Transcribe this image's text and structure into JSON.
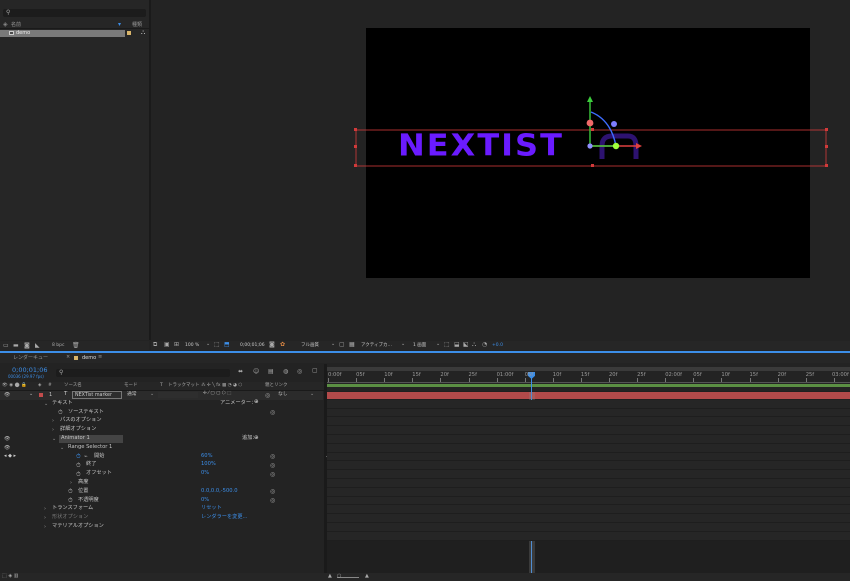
{
  "project": {
    "search_placeholder": "",
    "col_name": "名前",
    "col_type": "種類",
    "item_name": "demo",
    "bpc": "8 bpc"
  },
  "viewer": {
    "title_text": "NEXTIST",
    "zoom": "100 %",
    "timecode": "0;00;01;06",
    "resolution": "フル画質",
    "camera": "アクティブカ…",
    "views": "1 画面",
    "offset": "+0.0"
  },
  "timeline": {
    "tabs": [
      "レンダーキュー",
      "demo"
    ],
    "timecode": "0;00;01;06",
    "frame_info": "00036 (29.97 fps)",
    "col_source": "ソース名",
    "col_mode": "モード",
    "col_t": "T",
    "col_trkmat": "トラックマット",
    "col_parent": "親とリンク",
    "layer": {
      "num": "1",
      "name": "NEXTist marker",
      "mode": "通常",
      "parent": "なし"
    },
    "props": {
      "text": "テキスト",
      "animator_label": "アニメーター：",
      "source_text": "ソーステキスト",
      "path_options": "パスのオプション",
      "more_options": "詳細オプション",
      "animator1": "Animator 1",
      "add_label": "追加：",
      "range_selector": "Range Selector 1",
      "start": "開始",
      "start_value": "60%",
      "end": "終了",
      "end_value": "100%",
      "offset": "オフセット",
      "offset_value": "0%",
      "advanced": "高度",
      "position": "位置",
      "position_value": "0.0,0.0,-500.0",
      "opacity": "不透明度",
      "opacity_value": "0%",
      "transform": "トランスフォーム",
      "transform_value": "リセット",
      "geometry": "形状オプション",
      "material": "マテリアルオプション",
      "renderer_link": "レンダラーを変更..."
    },
    "ruler": [
      "0:00f",
      "05f",
      "10f",
      "15f",
      "20f",
      "25f",
      "01:00f",
      "05f",
      "10f",
      "15f",
      "20f",
      "25f",
      "02:00f",
      "05f",
      "10f",
      "15f",
      "20f",
      "25f",
      "03:00f"
    ]
  },
  "colors": {
    "accent": "#3c8ee8",
    "text_purple": "#6a1bff",
    "layer_bar": "#b24a4a",
    "work_bar": "#5b8f43"
  }
}
